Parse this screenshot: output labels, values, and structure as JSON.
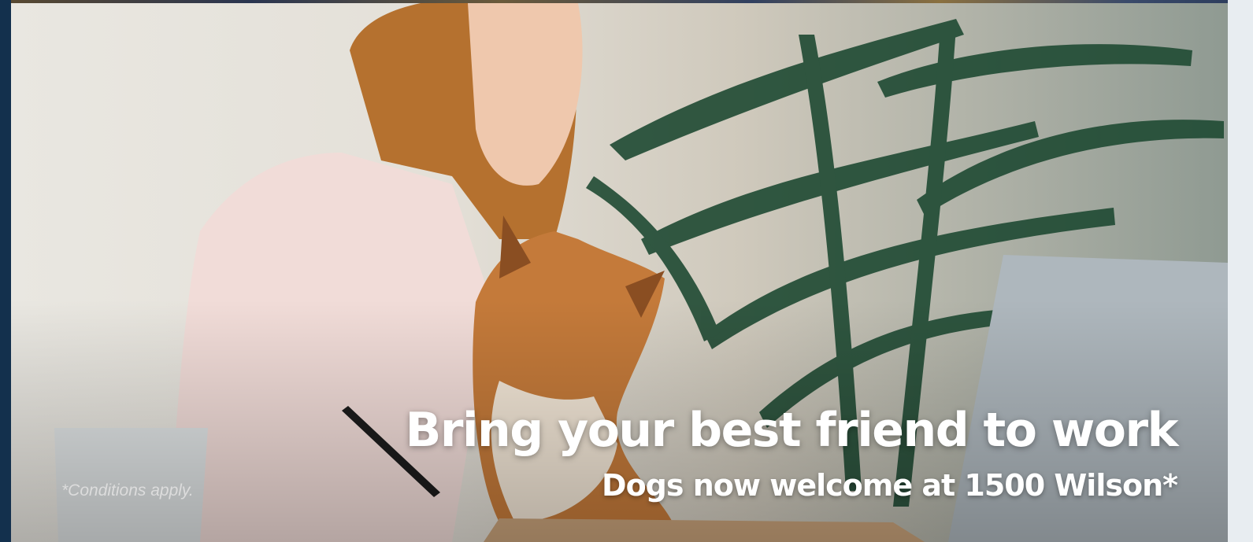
{
  "hero": {
    "headline": "Bring your best friend to work",
    "subheadline": "Dogs now welcome at 1500 Wilson*",
    "disclaimer": "*Conditions apply."
  },
  "colors": {
    "text": "#ffffff",
    "disclaimer": "#dcdcdc",
    "page_background": "#0f2a44"
  }
}
